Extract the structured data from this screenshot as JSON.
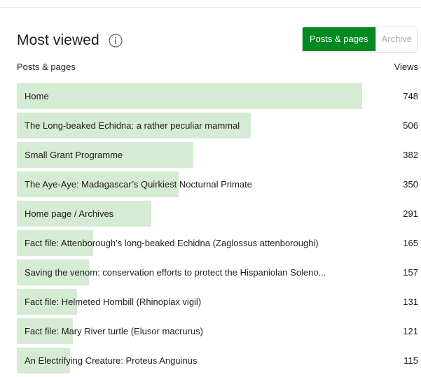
{
  "widget": {
    "title": "Most viewed",
    "info_icon": "info-circle-icon",
    "toggle": {
      "active_label": "Posts & pages",
      "inactive_label": "Archive",
      "active_color": "#008a20"
    },
    "columns": {
      "left": "Posts & pages",
      "right": "Views"
    },
    "bar_color": "#d5ebd3",
    "rows": [
      {
        "label": "Home",
        "views": 748
      },
      {
        "label": "The Long-beaked Echidna: a rather peculiar mammal",
        "views": 506
      },
      {
        "label": "Small Grant Programme",
        "views": 382
      },
      {
        "label": "The Aye-Aye: Madagascar’s Quirkiest Nocturnal Primate",
        "views": 350
      },
      {
        "label": "Home page / Archives",
        "views": 291
      },
      {
        "label": "Fact file: Attenborough’s long-beaked Echidna (Zaglossus attenboroughi)",
        "views": 165
      },
      {
        "label": "Saving the venom: conservation efforts to protect the Hispaniolan Soleno...",
        "views": 157
      },
      {
        "label": "Fact file: Helmeted Hornbill (Rhinoplax vigil)",
        "views": 131
      },
      {
        "label": "Fact file: Mary River turtle (Elusor macrurus)",
        "views": 121
      },
      {
        "label": "An Electrifying Creature: Proteus Anguinus",
        "views": 115
      }
    ]
  }
}
